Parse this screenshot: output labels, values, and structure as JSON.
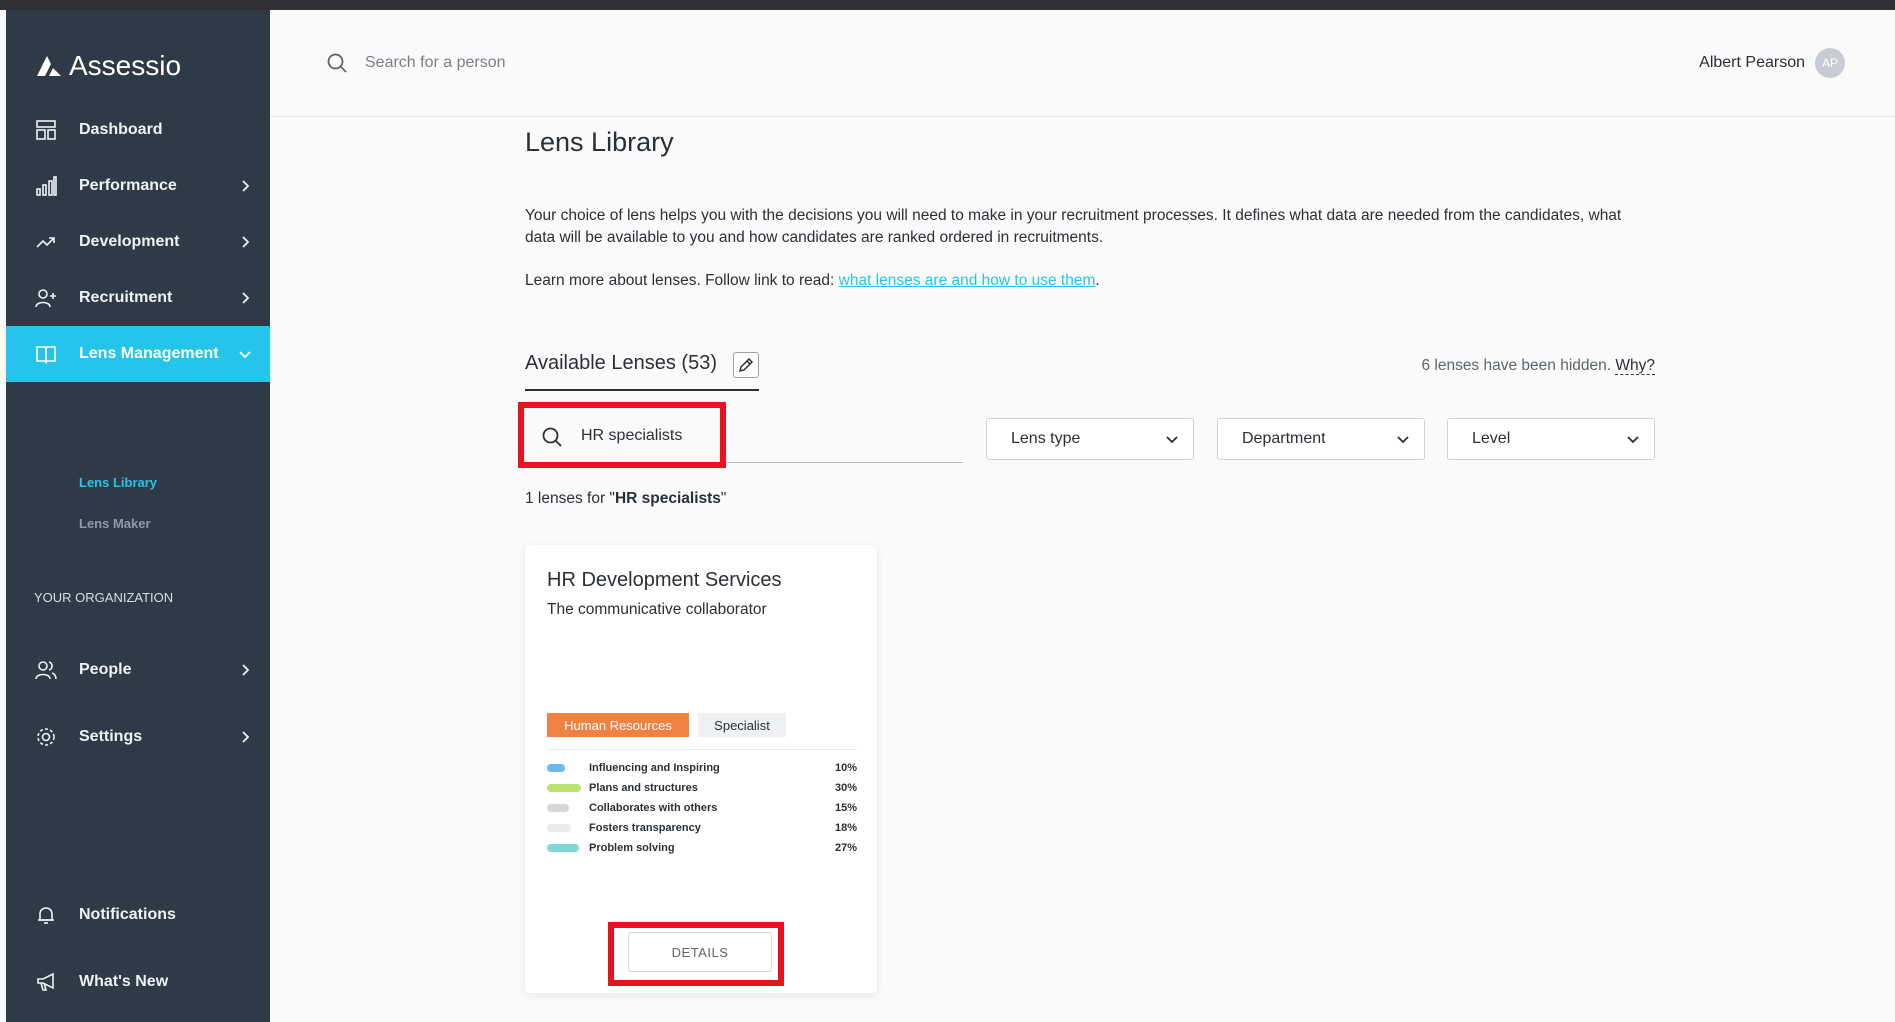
{
  "app": {
    "name": "Assessio",
    "accent": "#25c4ea",
    "sidebar_bg": "#2e3a46"
  },
  "sidebar": {
    "items": [
      {
        "label": "Dashboard",
        "icon": "dashboard-icon"
      },
      {
        "label": "Performance",
        "icon": "bar-chart-icon"
      },
      {
        "label": "Development",
        "icon": "trending-up-icon"
      },
      {
        "label": "Recruitment",
        "icon": "add-user-icon"
      },
      {
        "label": "Lens Management",
        "icon": "book-icon",
        "active": true
      }
    ],
    "sub_items": [
      {
        "label": "Lens Library",
        "active": true
      },
      {
        "label": "Lens Maker"
      }
    ],
    "org_section": "YOUR ORGANIZATION",
    "org_items": [
      {
        "label": "People",
        "icon": "people-icon"
      },
      {
        "label": "Settings",
        "icon": "gear-icon"
      }
    ],
    "bottom_items": [
      {
        "label": "Notifications",
        "icon": "bell-icon"
      },
      {
        "label": "What's New",
        "icon": "megaphone-icon"
      }
    ]
  },
  "header": {
    "search_placeholder": "Search for a person",
    "user_name": "Albert Pearson",
    "user_initials": "AP"
  },
  "main": {
    "title": "Lens Library",
    "description": "Your choice of lens helps you with the decisions you will need to make in your recruitment processes. It defines what data are needed from the candidates, what data will be available to you and how candidates are ranked ordered in recruitments.",
    "learn_prefix": "Learn more about lenses. Follow link to read: ",
    "learn_link": "what lenses are and how to use them",
    "learn_suffix": ".",
    "tab_label": "Available Lenses (53)",
    "hidden_note": "6 lenses have been hidden.",
    "hidden_why": "Why?",
    "search_value": "HR specialists",
    "filters": [
      "Lens type",
      "Department",
      "Level"
    ],
    "result_prefix": "1 lenses for \"",
    "result_query": "HR specialists",
    "result_suffix": "\""
  },
  "card": {
    "title": "HR Development Services",
    "subtitle": "The communicative collaborator",
    "tags": [
      {
        "label": "Human Resources",
        "color": "#ee8243"
      },
      {
        "label": "Specialist",
        "color": "#eef0f2"
      }
    ],
    "traits": [
      {
        "name": "Influencing and Inspiring",
        "percent": "10%",
        "color": "#6bb8ec"
      },
      {
        "name": "Plans and structures",
        "percent": "30%",
        "color": "#b9e36e"
      },
      {
        "name": "Collaborates with others",
        "percent": "15%",
        "color": "#d6d8db"
      },
      {
        "name": "Fosters transparency",
        "percent": "18%",
        "color": "#e9eaec"
      },
      {
        "name": "Problem solving",
        "percent": "27%",
        "color": "#7fd9d6"
      }
    ],
    "details_button": "DETAILS"
  }
}
